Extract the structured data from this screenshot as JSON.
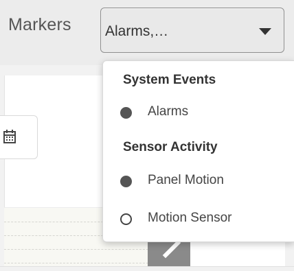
{
  "toolbar": {
    "markers_label": "Markers",
    "select_value": "Alarms,…"
  },
  "dropdown": {
    "groups": [
      {
        "header": "System Events",
        "options": [
          {
            "label": "Alarms",
            "selected": true,
            "icon": "filled-circle-icon"
          }
        ]
      },
      {
        "header": "Sensor Activity",
        "options": [
          {
            "label": "Panel Motion",
            "selected": true,
            "icon": "filled-circle-icon"
          },
          {
            "label": "Motion Sensor",
            "selected": false,
            "icon": "hollow-circle-icon"
          }
        ]
      }
    ]
  },
  "colors": {
    "toolbar_bg": "#ececec",
    "select_border": "#8f8f8f",
    "text": "#333333",
    "marker_fill": "#555555"
  }
}
